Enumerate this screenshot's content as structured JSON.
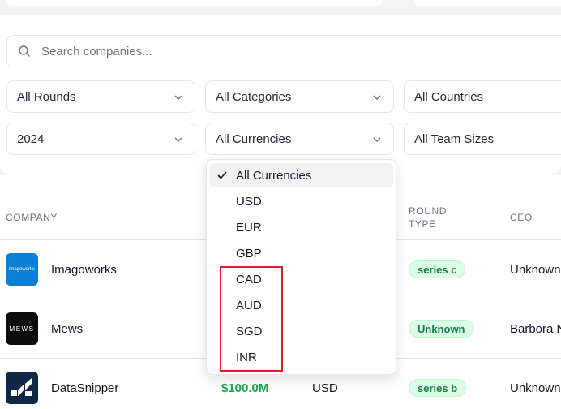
{
  "search": {
    "placeholder": "Search companies..."
  },
  "filters": {
    "rounds": "All Rounds",
    "categories": "All Categories",
    "countries": "All Countries",
    "year": "2024",
    "currencies": "All Currencies",
    "team_sizes": "All Team Sizes"
  },
  "currency_dropdown": {
    "options": [
      "All Currencies",
      "USD",
      "EUR",
      "GBP",
      "CAD",
      "AUD",
      "SGD",
      "INR"
    ],
    "selected": "All Currencies",
    "highlight_color": "#e11d2b"
  },
  "table": {
    "headers": {
      "company": "COMPANY",
      "round_type_1": "ROUND",
      "round_type_2": "TYPE",
      "ceo": "CEO"
    },
    "rows": [
      {
        "company": "Imagoworks",
        "logo_text": "imagoworks",
        "logo_color": "#0b7fd1",
        "round": "series c",
        "ceo": "Unknown",
        "amount": "",
        "currency": ""
      },
      {
        "company": "Mews",
        "logo_text": "MEWS",
        "logo_color": "#0d0d0d",
        "round": "Unknown",
        "ceo": "Barbora N",
        "amount": "",
        "currency": ""
      },
      {
        "company": "DataSnipper",
        "logo_text": "",
        "logo_color": "#0f2744",
        "round": "series b",
        "ceo": "Unknown",
        "amount": "$100.0M",
        "currency": "USD"
      }
    ]
  },
  "colors": {
    "badge_bg": "#dcfce7",
    "badge_text": "#15803d",
    "amount": "#16a34a"
  }
}
